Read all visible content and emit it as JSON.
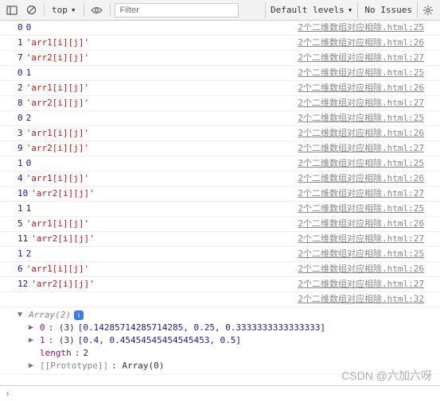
{
  "toolbar": {
    "context": "top",
    "filter_placeholder": "Filter",
    "levels": "Default levels",
    "issues": "No Issues"
  },
  "logs": [
    {
      "left": [
        {
          "t": "num",
          "v": "0"
        },
        {
          "t": "num",
          "v": "0"
        }
      ],
      "src": "2个二维数组对应相除.html:25"
    },
    {
      "left": [
        {
          "t": "num",
          "v": "1"
        },
        {
          "t": "str",
          "v": "'arr1[i][j]'"
        }
      ],
      "src": "2个二维数组对应相除.html:26"
    },
    {
      "left": [
        {
          "t": "num",
          "v": "7"
        },
        {
          "t": "str",
          "v": "'arr2[i][j]'"
        }
      ],
      "src": "2个二维数组对应相除.html:27"
    },
    {
      "left": [
        {
          "t": "num",
          "v": "0"
        },
        {
          "t": "num",
          "v": "1"
        }
      ],
      "src": "2个二维数组对应相除.html:25"
    },
    {
      "left": [
        {
          "t": "num",
          "v": "2"
        },
        {
          "t": "str",
          "v": "'arr1[i][j]'"
        }
      ],
      "src": "2个二维数组对应相除.html:26"
    },
    {
      "left": [
        {
          "t": "num",
          "v": "8"
        },
        {
          "t": "str",
          "v": "'arr2[i][j]'"
        }
      ],
      "src": "2个二维数组对应相除.html:27"
    },
    {
      "left": [
        {
          "t": "num",
          "v": "0"
        },
        {
          "t": "num",
          "v": "2"
        }
      ],
      "src": "2个二维数组对应相除.html:25"
    },
    {
      "left": [
        {
          "t": "num",
          "v": "3"
        },
        {
          "t": "str",
          "v": "'arr1[i][j]'"
        }
      ],
      "src": "2个二维数组对应相除.html:26"
    },
    {
      "left": [
        {
          "t": "num",
          "v": "9"
        },
        {
          "t": "str",
          "v": "'arr2[i][j]'"
        }
      ],
      "src": "2个二维数组对应相除.html:27"
    },
    {
      "left": [
        {
          "t": "num",
          "v": "1"
        },
        {
          "t": "num",
          "v": "0"
        }
      ],
      "src": "2个二维数组对应相除.html:25"
    },
    {
      "left": [
        {
          "t": "num",
          "v": "4"
        },
        {
          "t": "str",
          "v": "'arr1[i][j]'"
        }
      ],
      "src": "2个二维数组对应相除.html:26"
    },
    {
      "left": [
        {
          "t": "num",
          "v": "10"
        },
        {
          "t": "str",
          "v": "'arr2[i][j]'"
        }
      ],
      "src": "2个二维数组对应相除.html:27"
    },
    {
      "left": [
        {
          "t": "num",
          "v": "1"
        },
        {
          "t": "num",
          "v": "1"
        }
      ],
      "src": "2个二维数组对应相除.html:25"
    },
    {
      "left": [
        {
          "t": "num",
          "v": "5"
        },
        {
          "t": "str",
          "v": "'arr1[i][j]'"
        }
      ],
      "src": "2个二维数组对应相除.html:26"
    },
    {
      "left": [
        {
          "t": "num",
          "v": "11"
        },
        {
          "t": "str",
          "v": "'arr2[i][j]'"
        }
      ],
      "src": "2个二维数组对应相除.html:27"
    },
    {
      "left": [
        {
          "t": "num",
          "v": "1"
        },
        {
          "t": "num",
          "v": "2"
        }
      ],
      "src": "2个二维数组对应相除.html:25"
    },
    {
      "left": [
        {
          "t": "num",
          "v": "6"
        },
        {
          "t": "str",
          "v": "'arr1[i][j]'"
        }
      ],
      "src": "2个二维数组对应相除.html:26"
    },
    {
      "left": [
        {
          "t": "num",
          "v": "12"
        },
        {
          "t": "str",
          "v": "'arr2[i][j]'"
        }
      ],
      "src": "2个二维数组对应相除.html:27"
    },
    {
      "left": [],
      "src": "2个二维数组对应相除.html:32"
    }
  ],
  "array_obj": {
    "header": "Array(2)",
    "rows": [
      {
        "key": "0",
        "meta": "(3)",
        "vals": "[0.14285714285714285, 0.25, 0.3333333333333333]"
      },
      {
        "key": "1",
        "meta": "(3)",
        "vals": "[0.4, 0.45454545454545453, 0.5]"
      }
    ],
    "length_label": "length",
    "length_val": "2",
    "proto_label": "[[Prototype]]",
    "proto_val": "Array(0)"
  },
  "watermark": "CSDN @六加六呀"
}
